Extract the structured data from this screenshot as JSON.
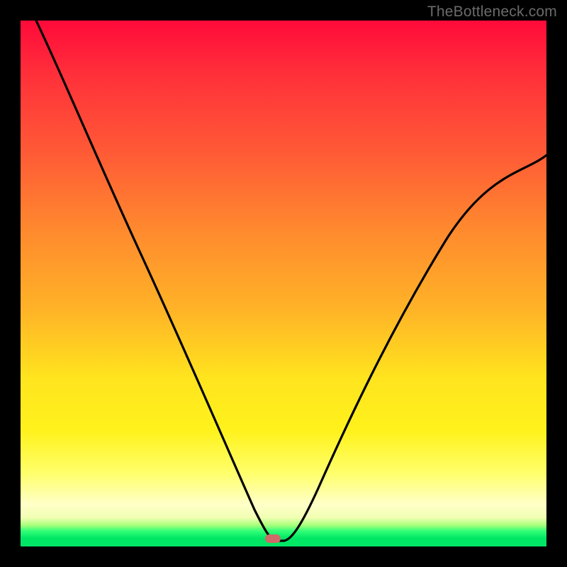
{
  "watermark": "TheBottleneck.com",
  "chart_data": {
    "type": "line",
    "title": "",
    "xlabel": "",
    "ylabel": "",
    "xlim": [
      0,
      100
    ],
    "ylim": [
      0,
      100
    ],
    "grid": false,
    "legend": false,
    "background_gradient_top": "#ff0a3a",
    "background_gradient_bottom": "#00e765",
    "series": [
      {
        "name": "bottleneck-curve",
        "color": "#000000",
        "x": [
          3,
          8,
          14,
          20,
          26,
          32,
          36,
          40,
          43,
          45,
          47,
          49,
          53,
          57,
          62,
          68,
          75,
          82,
          90,
          97,
          100
        ],
        "values": [
          100,
          87,
          71,
          56,
          43,
          30,
          21,
          13,
          7,
          3,
          1,
          0,
          3,
          8,
          15,
          24,
          35,
          46,
          59,
          70,
          75
        ]
      }
    ],
    "marker": {
      "x": 48,
      "y": 1.5,
      "color": "#cf6a6a"
    },
    "annotations": []
  }
}
